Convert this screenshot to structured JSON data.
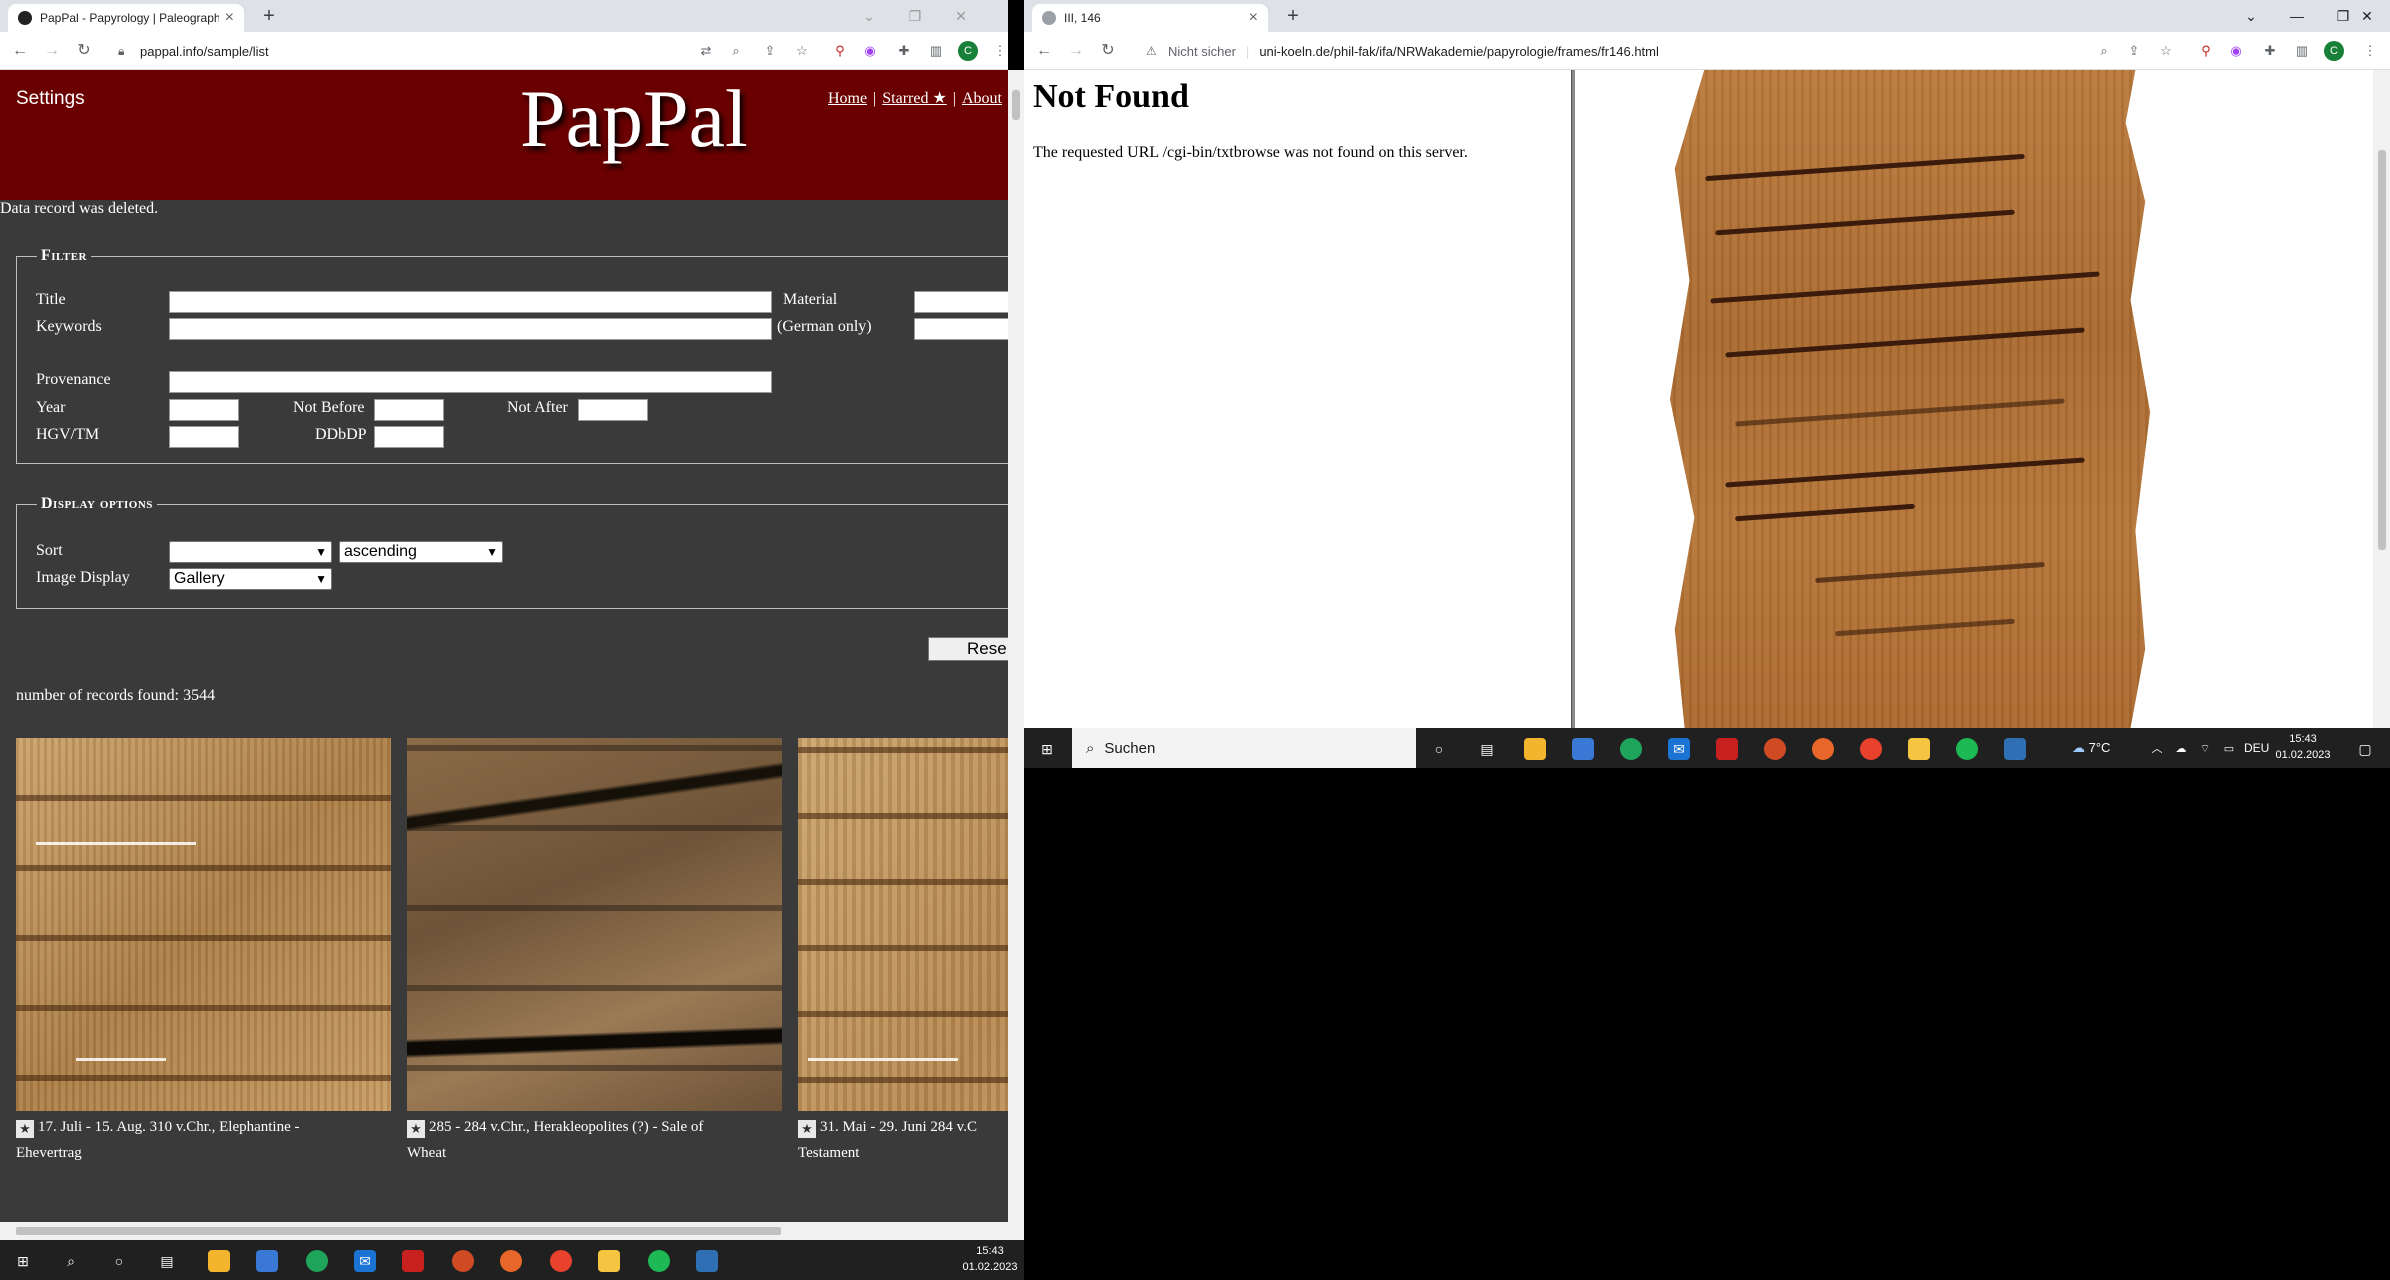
{
  "left_browser": {
    "tab_title": "PapPal - Papyrology | Paleograph",
    "url": "pappal.info/sample/list"
  },
  "pappal": {
    "settings_label": "Settings",
    "logo": "PapPal",
    "nav": {
      "home": "Home",
      "starred": "Starred ★",
      "about": "About"
    },
    "message": "Data record was deleted.",
    "filter": {
      "legend": "Filter",
      "title_label": "Title",
      "keywords_label": "Keywords",
      "material_label": "Material",
      "german_only_label": "(German only)",
      "provenance_label": "Provenance",
      "year_label": "Year",
      "not_before_label": "Not Before",
      "not_after_label": "Not After",
      "hgv_tm_label": "HGV/TM",
      "ddbdp_label": "DDbDP"
    },
    "display": {
      "legend": "Display options",
      "sort_label": "Sort",
      "sort_value": "",
      "order_value": "ascending",
      "image_display_label": "Image Display",
      "image_display_value": "Gallery"
    },
    "reset_label": "Rese",
    "records_found": "number of records found: 3544",
    "gallery": [
      {
        "caption_line1": "17. Juli - 15. Aug. 310 v.Chr., Elephantine -",
        "caption_line2": "Ehevertrag"
      },
      {
        "caption_line1": "285 - 284 v.Chr., Herakleopolites (?) - Sale of",
        "caption_line2": "Wheat"
      },
      {
        "caption_line1": "31. Mai - 29. Juni 284 v.C",
        "caption_line2": "Testament"
      }
    ]
  },
  "right_browser": {
    "tab_title": "III, 146",
    "security_label": "Nicht sicher",
    "url": "uni-koeln.de/phil-fak/ifa/NRWakademie/papyrologie/frames/fr146.html",
    "not_found_title": "Not Found",
    "not_found_text": "The requested URL /cgi-bin/txtbrowse was not found on this server."
  },
  "taskbar_left": {
    "time": "15:43",
    "date": "01.02.2023"
  },
  "taskbar_right": {
    "search_label": "Suchen",
    "weather": "7°C",
    "language": "DEU",
    "time": "15:43",
    "date": "01.02.2023"
  },
  "colors": {
    "pappal_header": "#6b0000",
    "pappal_background": "#3a3a3a",
    "taskbar": "#202020",
    "chrome_tabstrip": "#dee1e6"
  }
}
